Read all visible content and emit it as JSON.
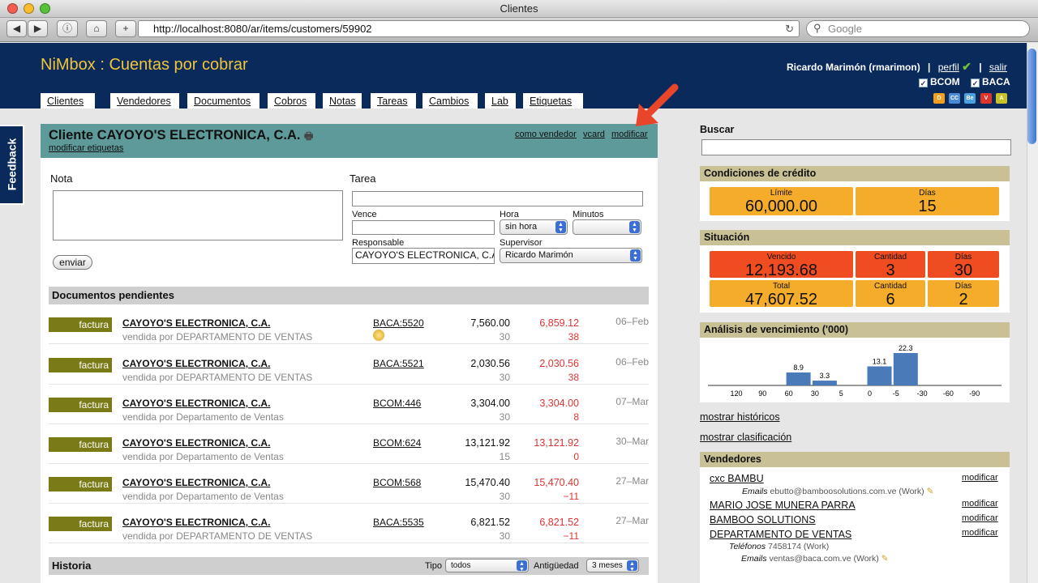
{
  "window": {
    "title": "Clientes"
  },
  "browser": {
    "url": "http://localhost:8080/ar/items/customers/59902",
    "search_placeholder": "Google"
  },
  "header": {
    "app_title": "NiMbox : Cuentas por cobrar",
    "user": "Ricardo Marimón (rmarimon)",
    "sep": "|",
    "profile_link": "perfil",
    "logout_link": "salir",
    "companies": [
      "BCOM",
      "BACA"
    ],
    "badges": [
      "D",
      "CC",
      "Be",
      "V",
      "A"
    ]
  },
  "tabs": [
    "Clientes",
    "Vendedores",
    "Documentos",
    "Cobros",
    "Notas",
    "Tareas",
    "Cambios",
    "Lab",
    "Etiquetas"
  ],
  "feedback": "Feedback",
  "customer": {
    "title": "Cliente CAYOYO'S ELECTRONICA, C.A.",
    "edit_tags": "modificar etiquetas",
    "links": [
      "como vendedor",
      "vcard",
      "modificar"
    ]
  },
  "form": {
    "note_label": "Nota",
    "task_label": "Tarea",
    "due_label": "Vence",
    "hour_label": "Hora",
    "hour_value": "sin hora",
    "minutes_label": "Minutos",
    "responsible_label": "Responsable",
    "responsible_value": "CAYOYO'S ELECTRONICA, C.A",
    "supervisor_label": "Supervisor",
    "supervisor_value": "Ricardo Marimón",
    "send_button": "enviar"
  },
  "pending": {
    "title": "Documentos pendientes",
    "rows": [
      {
        "type": "factura",
        "name": "CAYOYO'S ELECTRONICA, C.A.",
        "sold_by_prefix": "vendida por",
        "seller": "DEPARTAMENTO DE VENTAS",
        "ref": "BACA:5520",
        "amount": "7,560.00",
        "days1": "30",
        "balance": "6,859.12",
        "days2": "38",
        "date": "06–Feb"
      },
      {
        "type": "factura",
        "name": "CAYOYO'S ELECTRONICA, C.A.",
        "sold_by_prefix": "vendida por",
        "seller": "DEPARTAMENTO DE VENTAS",
        "ref": "BACA:5521",
        "amount": "2,030.56",
        "days1": "30",
        "balance": "2,030.56",
        "days2": "38",
        "date": "06–Feb"
      },
      {
        "type": "factura",
        "name": "CAYOYO'S ELECTRONICA, C.A.",
        "sold_by_prefix": "vendida por",
        "seller": "Departamento de Ventas",
        "ref": "BCOM:446",
        "amount": "3,304.00",
        "days1": "30",
        "balance": "3,304.00",
        "days2": "8",
        "date": "07–Mar"
      },
      {
        "type": "factura",
        "name": "CAYOYO'S ELECTRONICA, C.A.",
        "sold_by_prefix": "vendida por",
        "seller": "Departamento de Ventas",
        "ref": "BCOM:624",
        "amount": "13,121.92",
        "days1": "15",
        "balance": "13,121.92",
        "days2": "0",
        "date": "30–Mar"
      },
      {
        "type": "factura",
        "name": "CAYOYO'S ELECTRONICA, C.A.",
        "sold_by_prefix": "vendida por",
        "seller": "Departamento de Ventas",
        "ref": "BCOM:568",
        "amount": "15,470.40",
        "days1": "30",
        "balance": "15,470.40",
        "days2": "−11",
        "date": "27–Mar"
      },
      {
        "type": "factura",
        "name": "CAYOYO'S ELECTRONICA, C.A.",
        "sold_by_prefix": "vendida por",
        "seller": "DEPARTAMENTO DE VENTAS",
        "ref": "BACA:5535",
        "amount": "6,821.52",
        "days1": "30",
        "balance": "6,821.52",
        "days2": "−11",
        "date": "27–Mar"
      }
    ]
  },
  "history": {
    "title": "Historia",
    "type_label": "Tipo",
    "type_value": "todos",
    "age_label": "Antigüedad",
    "age_value": "3 meses"
  },
  "search": {
    "label": "Buscar"
  },
  "credit": {
    "title": "Condiciones de crédito",
    "limit_label": "Límite",
    "limit_value": "60,000.00",
    "days_label": "Días",
    "days_value": "15"
  },
  "situation": {
    "title": "Situación",
    "overdue_label": "Vencido",
    "overdue_value": "12,193.68",
    "overdue_qty_label": "Cantidad",
    "overdue_qty": "3",
    "overdue_days_label": "Días",
    "overdue_days": "30",
    "total_label": "Total",
    "total_value": "47,607.52",
    "total_qty_label": "Cantidad",
    "total_qty": "6",
    "total_days_label": "Días",
    "total_days": "2"
  },
  "aging": {
    "title": "Análisis de vencimiento ('000)"
  },
  "chart_data": {
    "type": "bar",
    "categories": [
      "120",
      "90",
      "60",
      "30",
      "5",
      "0",
      "-5",
      "-30",
      "-60",
      "-90"
    ],
    "values": [
      0,
      0,
      8.9,
      3.3,
      0,
      13.1,
      22.3,
      0,
      0,
      0
    ],
    "labels": [
      "",
      "",
      "8.9",
      "3.3",
      "",
      "13.1",
      "22.3",
      "",
      "",
      ""
    ],
    "color": "#4a7ab8",
    "ylim": [
      0,
      22.3
    ]
  },
  "show_history": "mostrar históricos",
  "show_classification": "mostrar clasificación",
  "sellers": {
    "title": "Vendedores",
    "modify": "modificar",
    "entries": [
      {
        "name": "cxc BAMBU",
        "detail_label": "Emails",
        "detail_value": "ebutto@bamboosolutions.com.ve",
        "detail_suffix": "(Work)"
      },
      {
        "name": "MARIO JOSE MUNERA PARRA"
      },
      {
        "name": "BAMBOO SOLUTIONS"
      },
      {
        "name": "DEPARTAMENTO DE VENTAS",
        "phone_label": "Teléfonos",
        "phone_value": "7458174",
        "phone_suffix": "(Work)",
        "detail_label": "Emails",
        "detail_value": "ventas@baca.com.ve",
        "detail_suffix": "(Work)"
      }
    ]
  }
}
